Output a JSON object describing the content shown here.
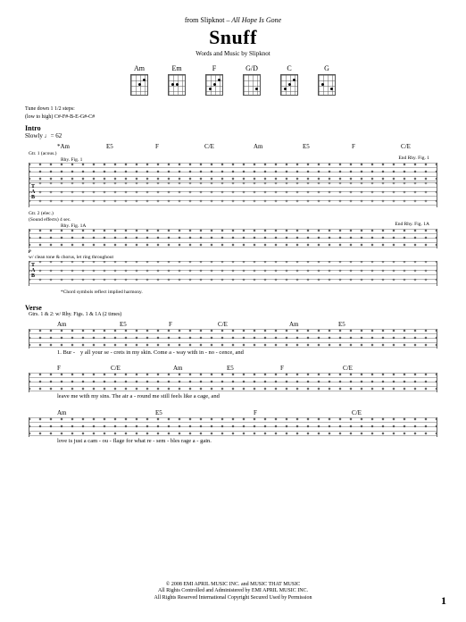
{
  "header": {
    "from_label": "from Slipknot –",
    "album": "All Hope Is Gone",
    "title": "Snuff",
    "byline": "Words and Music by Slipknot"
  },
  "chord_diagrams": [
    "Am",
    "Em",
    "F",
    "G/D",
    "C",
    "G"
  ],
  "tuning_note_1": "Tune down 1 1/2 steps:",
  "tuning_note_2": "(low to high) C#-F#-B-E-G#-C#",
  "intro": {
    "label": "Intro",
    "tempo": "Slowly ♩= 62",
    "chords_line": [
      "*Am",
      "E5",
      "F",
      "C/E",
      "Am",
      "E5",
      "F",
      "C/E"
    ],
    "gtr1_label": "Gtr. 1 (acous.)",
    "gtr2_label": "Gtr. 2 (elec.)",
    "sfx_note": "(Sound effects) 4 sec.",
    "rhy_fig_1": "Rhy. Fig. 1",
    "rhy_fig_1a": "Rhy. Fig. 1A",
    "end_rhy_1": "End Rhy. Fig. 1",
    "end_rhy_1a": "End Rhy. Fig. 1A",
    "dyn": "p",
    "fx_note": "w/ clean tone & chorus, let ring throughout",
    "footnote": "*Chord symbols reflect implied harmony."
  },
  "verse": {
    "label": "Verse",
    "gtr_note": "Gtrs. 1 & 2: w/ Rhy. Figs. 1 & 1A (2 times)",
    "sys1": {
      "chords": [
        "Am",
        "E5",
        "F",
        "C/E",
        "Am",
        "E5"
      ],
      "lyric_num": "1. Bur -",
      "lyrics": "y    all    your    se - crets in    my    skin.              Come a - way    with    in  -  no - cence,    and"
    },
    "sys2": {
      "chords": [
        "F",
        "C/E",
        "Am",
        "E5",
        "F",
        "C/E"
      ],
      "lyrics": "leave me    with    my    sins.           The    air    a - round    me    still    feels    like    a    cage,                      and"
    },
    "sys3": {
      "chords": [
        "Am",
        "E5",
        "F",
        "C/E"
      ],
      "lyrics": "love    is    just    a    cam  -  ou  -  flage        for    what    re  -  sem - bles    rage        a - gain."
    }
  },
  "footer": {
    "c1": "© 2008 EMI APRIL MUSIC INC. and MUSIC THAT MUSIC",
    "c2": "All Rights Controlled and Administered by EMI APRIL MUSIC INC.",
    "c3": "All Rights Reserved   International Copyright Secured   Used by Permission",
    "page": "1"
  }
}
